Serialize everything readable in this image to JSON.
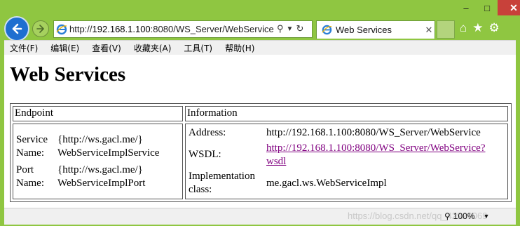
{
  "browser": {
    "address_prefix": "http://",
    "address_host": "192.168.1.100",
    "address_rest": ":8080/WS_Server/WebService",
    "tab_title": "Web Services",
    "window_controls": [
      "minimize-icon",
      "maximize-icon",
      "close-icon"
    ],
    "toolbar_icons": [
      "home-icon",
      "star-icon",
      "gear-icon"
    ]
  },
  "menu": {
    "items": [
      "文件(F)",
      "编辑(E)",
      "查看(V)",
      "收藏夹(A)",
      "工具(T)",
      "帮助(H)"
    ]
  },
  "page": {
    "heading": "Web Services",
    "table": {
      "col_endpoint": "Endpoint",
      "col_information": "Information",
      "service_name_label": "Service Name:",
      "service_name_value_1": "{http://ws.gacl.me/}",
      "service_name_value_2": "WebServiceImplService",
      "port_name_label": "Port Name:",
      "port_name_value_1": "{http://ws.gacl.me/}",
      "port_name_value_2": "WebServiceImplPort",
      "address_label": "Address:",
      "address_value": "http://192.168.1.100:8080/WS_Server/WebService",
      "wsdl_label": "WSDL:",
      "wsdl_link_1": "http://192.168.1.100:8080/WS_Server/WebService?",
      "wsdl_link_2": "wsdl",
      "impl_label_1": "Implementation",
      "impl_label_2": "class:",
      "impl_value": "me.gacl.ws.WebServiceImpl"
    }
  },
  "status": {
    "zoom": "100%",
    "watermark": "https://blog.csdn.net/qq_42920069"
  }
}
